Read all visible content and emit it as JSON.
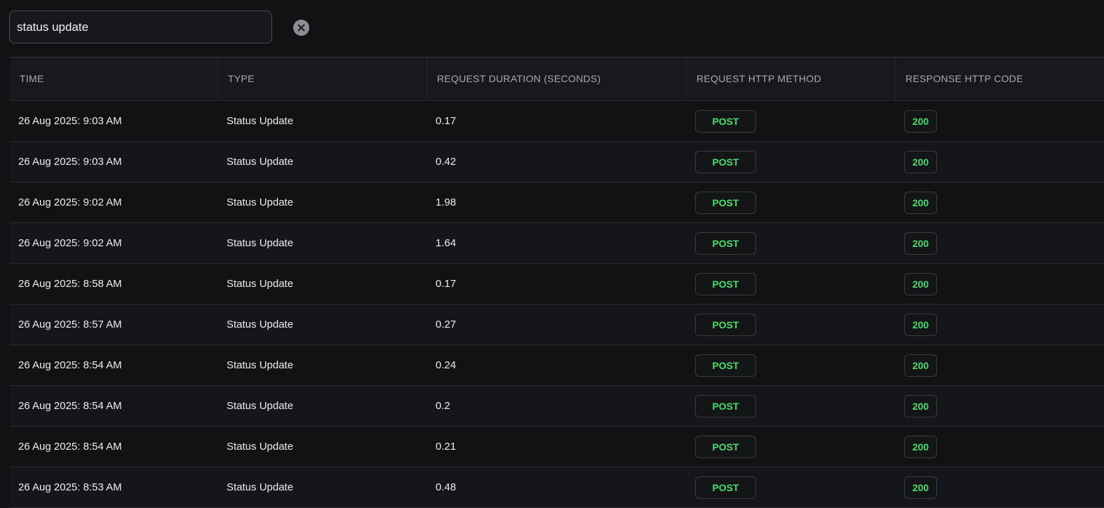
{
  "search": {
    "value": "status update",
    "clear_icon": "close-circle-icon"
  },
  "table": {
    "headers": [
      "TIME",
      "TYPE",
      "REQUEST DURATION (SECONDS)",
      "REQUEST HTTP METHOD",
      "RESPONSE HTTP CODE"
    ],
    "rows": [
      {
        "time": "26 Aug 2025: 9:03 AM",
        "type": "Status Update",
        "duration": "0.17",
        "method": "POST",
        "code": "200"
      },
      {
        "time": "26 Aug 2025: 9:03 AM",
        "type": "Status Update",
        "duration": "0.42",
        "method": "POST",
        "code": "200"
      },
      {
        "time": "26 Aug 2025: 9:02 AM",
        "type": "Status Update",
        "duration": "1.98",
        "method": "POST",
        "code": "200"
      },
      {
        "time": "26 Aug 2025: 9:02 AM",
        "type": "Status Update",
        "duration": "1.64",
        "method": "POST",
        "code": "200"
      },
      {
        "time": "26 Aug 2025: 8:58 AM",
        "type": "Status Update",
        "duration": "0.17",
        "method": "POST",
        "code": "200"
      },
      {
        "time": "26 Aug 2025: 8:57 AM",
        "type": "Status Update",
        "duration": "0.27",
        "method": "POST",
        "code": "200"
      },
      {
        "time": "26 Aug 2025: 8:54 AM",
        "type": "Status Update",
        "duration": "0.24",
        "method": "POST",
        "code": "200"
      },
      {
        "time": "26 Aug 2025: 8:54 AM",
        "type": "Status Update",
        "duration": "0.2",
        "method": "POST",
        "code": "200"
      },
      {
        "time": "26 Aug 2025: 8:54 AM",
        "type": "Status Update",
        "duration": "0.21",
        "method": "POST",
        "code": "200"
      },
      {
        "time": "26 Aug 2025: 8:53 AM",
        "type": "Status Update",
        "duration": "0.48",
        "method": "POST",
        "code": "200"
      }
    ]
  },
  "colors": {
    "background": "#121214",
    "success_green": "#4ade6e",
    "header_text": "#a9aab0"
  }
}
